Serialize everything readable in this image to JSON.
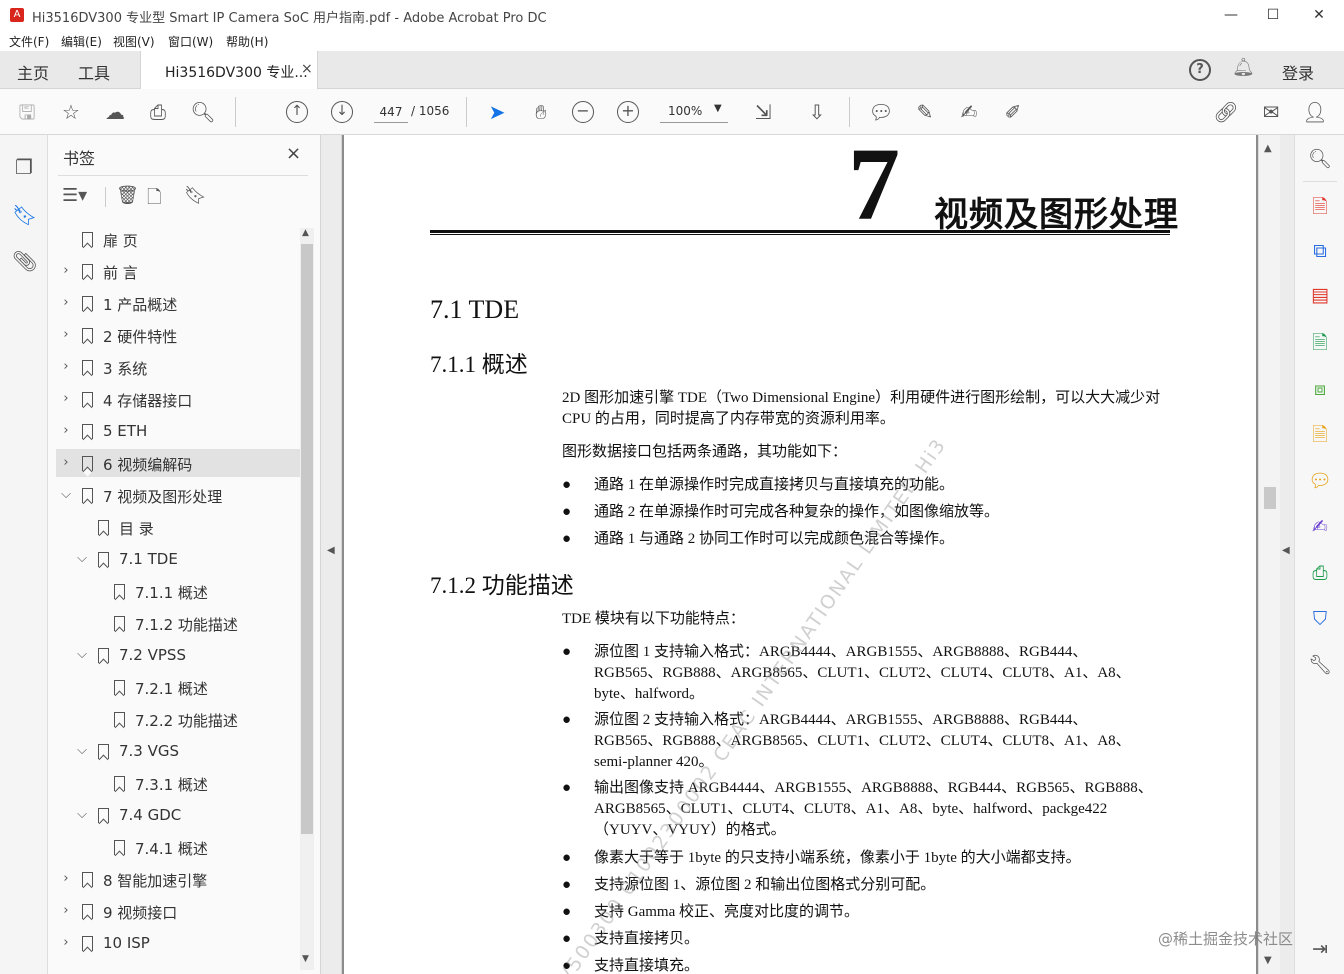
{
  "window": {
    "title": "Hi3516DV300 专业型 Smart IP Camera SoC 用户指南.pdf - Adobe Acrobat Pro DC",
    "controls": [
      "—",
      "☐",
      "✕"
    ]
  },
  "menu": [
    "文件(F)",
    "编辑(E)",
    "视图(V)",
    "窗口(W)",
    "帮助(H)"
  ],
  "tabs": {
    "home": "主页",
    "tools": "工具",
    "document": "Hi3516DV300 专业...",
    "close": "×",
    "signin": "登录"
  },
  "toolbar": {
    "page_current": "447",
    "page_total": "/ 1056",
    "zoom": "100%"
  },
  "bookmarks": {
    "title": "书签",
    "close": "×",
    "items": [
      {
        "label": "扉 页",
        "level": 0,
        "expand": "none"
      },
      {
        "label": "前 言",
        "level": 0,
        "expand": "collapsed"
      },
      {
        "label": "1 产品概述",
        "level": 0,
        "expand": "collapsed"
      },
      {
        "label": "2 硬件特性",
        "level": 0,
        "expand": "collapsed"
      },
      {
        "label": "3 系统",
        "level": 0,
        "expand": "collapsed"
      },
      {
        "label": "4 存储器接口",
        "level": 0,
        "expand": "collapsed"
      },
      {
        "label": "5 ETH",
        "level": 0,
        "expand": "collapsed"
      },
      {
        "label": "6 视频编解码",
        "level": 0,
        "expand": "collapsed",
        "selected": true
      },
      {
        "label": "7 视频及图形处理",
        "level": 0,
        "expand": "expanded"
      },
      {
        "label": "目 录",
        "level": 1,
        "expand": "none"
      },
      {
        "label": "7.1 TDE",
        "level": 1,
        "expand": "expanded"
      },
      {
        "label": "7.1.1 概述",
        "level": 2,
        "expand": "none"
      },
      {
        "label": "7.1.2 功能描述",
        "level": 2,
        "expand": "none"
      },
      {
        "label": "7.2 VPSS",
        "level": 1,
        "expand": "expanded"
      },
      {
        "label": "7.2.1 概述",
        "level": 2,
        "expand": "none"
      },
      {
        "label": "7.2.2 功能描述",
        "level": 2,
        "expand": "none"
      },
      {
        "label": "7.3 VGS",
        "level": 1,
        "expand": "expanded"
      },
      {
        "label": "7.3.1 概述",
        "level": 2,
        "expand": "none"
      },
      {
        "label": "7.4 GDC",
        "level": 1,
        "expand": "expanded"
      },
      {
        "label": "7.4.1 概述",
        "level": 2,
        "expand": "none"
      },
      {
        "label": "8 智能加速引擎",
        "level": 0,
        "expand": "collapsed"
      },
      {
        "label": "9 视频接口",
        "level": 0,
        "expand": "collapsed"
      },
      {
        "label": "10 ISP",
        "level": 0,
        "expand": "collapsed"
      }
    ]
  },
  "page": {
    "chapter_number": "7",
    "chapter_title": "视频及图形处理",
    "h_71": "7.1 TDE",
    "h_711": "7.1.1 概述",
    "p1": "2D 图形加速引擎 TDE（Two Dimensional Engine）利用硬件进行图形绘制，可以大大减少对 CPU 的占用，同时提高了内存带宽的资源利用率。",
    "p2": "图形数据接口包括两条通路，其功能如下：",
    "bullets1": [
      "通路 1 在单源操作时完成直接拷贝与直接填充的功能。",
      "通路 2 在单源操作时可完成各种复杂的操作，如图像缩放等。",
      "通路 1 与通路 2 协同工作时可以完成颜色混合等操作。"
    ],
    "h_712": "7.1.2 功能描述",
    "p3": "TDE 模块有以下功能特点：",
    "bullets2": [
      "源位图 1 支持输入格式：ARGB4444、ARGB1555、ARGB8888、RGB444、RGB565、RGB888、ARGB8565、CLUT1、CLUT2、CLUT4、CLUT8、A1、A8、byte、halfword。",
      "源位图 2 支持输入格式：ARGB4444、ARGB1555、ARGB8888、RGB444、RGB565、RGB888、ARGB8565、CLUT1、CLUT2、CLUT4、CLUT8、A1、A8、semi-planner 420。",
      "输出图像支持 ARGB4444、ARGB1555、ARGB8888、RGB444、RGB565、RGB888、ARGB8565、CLUT1、CLUT4、CLUT8、A1、A8、byte、halfword、packge422（YUYV、VYUY）的格式。",
      "像素大于等于 1byte 的只支持小端系统，像素小于 1byte 的大小端都支持。",
      "支持源位图 1、源位图 2 和输出位图格式分别可配。",
      "支持 Gamma 校正、亮度对比度的调节。",
      "支持直接拷贝。",
      "支持直接填充。"
    ],
    "watermark": "V500300 01002300002 CEAC INTERNATIONAL LIMITED Hi3"
  },
  "credit": "@稀土掘金技术社区",
  "colors": {
    "accent": "#1473e6",
    "pdf_red": "#d9261c"
  }
}
